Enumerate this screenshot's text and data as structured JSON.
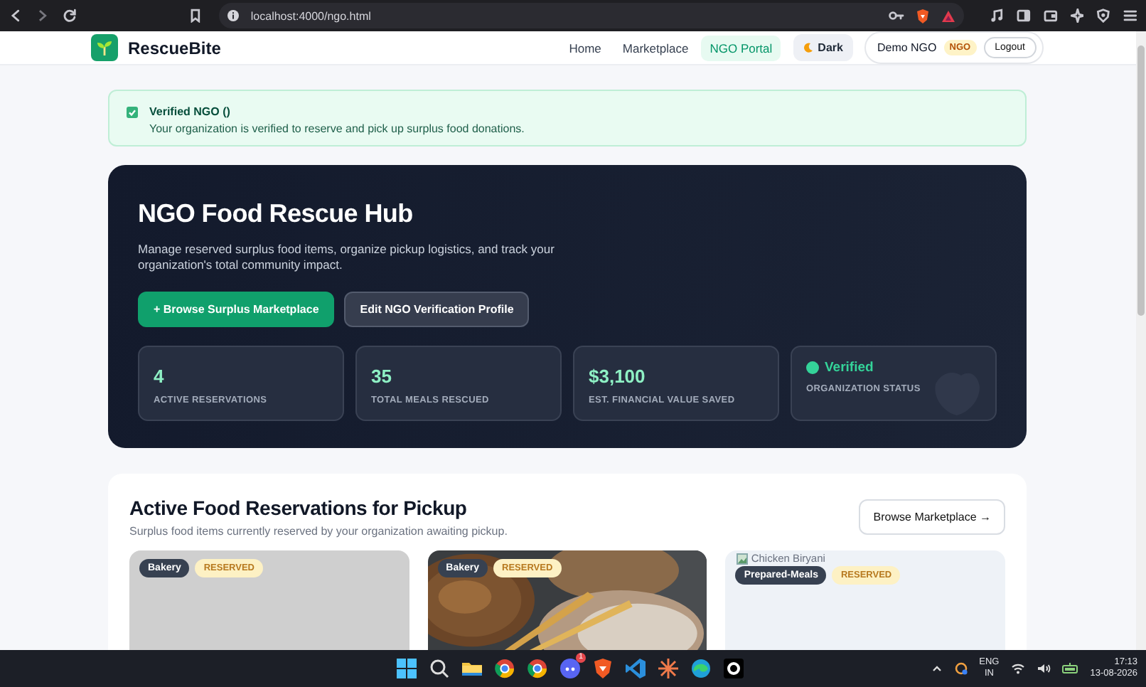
{
  "browser": {
    "url": "localhost:4000/ngo.html"
  },
  "nav": {
    "brand": "RescueBite",
    "links": [
      {
        "label": "Home",
        "selected": false
      },
      {
        "label": "Marketplace",
        "selected": false
      },
      {
        "label": "NGO Portal",
        "selected": true
      }
    ],
    "theme_button": "Dark",
    "user": "Demo NGO",
    "role_badge": "NGO",
    "logout": "Logout"
  },
  "banner": {
    "checked": true,
    "title": "Verified NGO ()",
    "message": "Your organization is verified to reserve and pick up surplus food donations."
  },
  "hero": {
    "title": "NGO Food Rescue Hub",
    "description": "Manage reserved surplus food items, organize pickup logistics, and track your organization's total community impact.",
    "primary_button": "+ Browse Surplus Marketplace",
    "secondary_button": "Edit NGO Verification Profile",
    "stats": [
      {
        "kind": "number",
        "value": "4",
        "label": "ACTIVE RESERVATIONS"
      },
      {
        "kind": "number",
        "value": "35",
        "label": "TOTAL MEALS RESCUED"
      },
      {
        "kind": "number",
        "value": "$3,100",
        "label": "EST. FINANCIAL VALUE SAVED"
      },
      {
        "kind": "status",
        "value": "Verified",
        "label": "ORGANIZATION STATUS"
      }
    ]
  },
  "reservations": {
    "title": "Active Food Reservations for Pickup",
    "subtitle": "Surplus food items currently reserved by your organization awaiting pickup.",
    "button": "Browse Marketplace →",
    "cards": [
      {
        "kind": "blank",
        "category": "Bakery",
        "status": "RESERVED"
      },
      {
        "kind": "picture",
        "category": "Bakery",
        "status": "RESERVED"
      },
      {
        "kind": "broken",
        "alt": "Chicken Biryani",
        "category": "Prepared-Meals",
        "status": "RESERVED"
      }
    ]
  },
  "taskbar": {
    "notification_badge": "1",
    "language": "ENG",
    "region": "IN",
    "time": "17:13",
    "date": "13-08-2026"
  }
}
